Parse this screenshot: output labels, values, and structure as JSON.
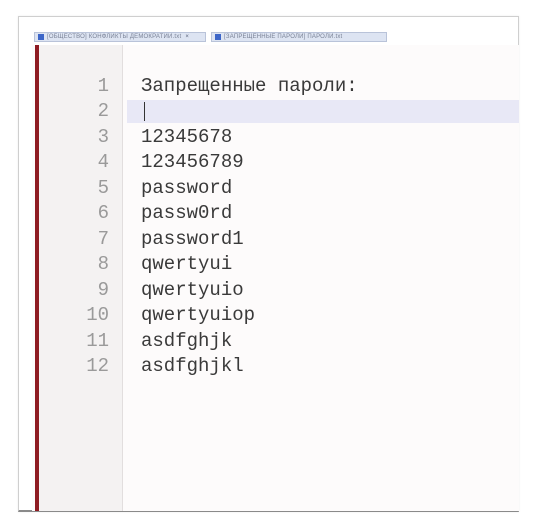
{
  "tabs": [
    {
      "label": "[ОБЩЕСТВО] КОНФЛИКТЫ ДЕМОКРАТИИ.txt",
      "close": "×"
    },
    {
      "label": "[ЗАПРЕЩЕННЫЕ ПАРОЛИ] ПАРОЛИ.txt",
      "close": ""
    }
  ],
  "editor": {
    "lines": [
      {
        "number": "1",
        "text": "Запрещенные пароли:"
      },
      {
        "number": "2",
        "text": ""
      },
      {
        "number": "3",
        "text": "12345678"
      },
      {
        "number": "4",
        "text": "123456789"
      },
      {
        "number": "5",
        "text": "password"
      },
      {
        "number": "6",
        "text": "passw0rd"
      },
      {
        "number": "7",
        "text": "password1"
      },
      {
        "number": "8",
        "text": "qwertyui"
      },
      {
        "number": "9",
        "text": "qwertyuio"
      },
      {
        "number": "10",
        "text": "qwertyuiop"
      },
      {
        "number": "11",
        "text": "asdfghjk"
      },
      {
        "number": "12",
        "text": "asdfghjkl"
      }
    ],
    "current_line": "2"
  },
  "colors": {
    "margin_rule": "#8e1b22",
    "current_line_highlight": "#e8e8f6",
    "tab_icon": "#3d66c8"
  }
}
